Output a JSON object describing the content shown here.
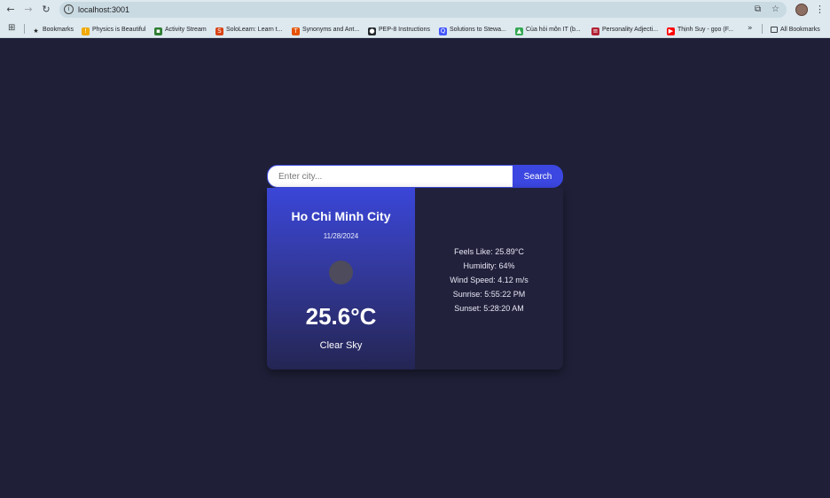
{
  "browser": {
    "url": "localhost:3001",
    "bookmarks": [
      {
        "label": "Bookmarks",
        "icon": "star-icon",
        "glyph": "★",
        "color": "#202124"
      },
      {
        "label": "Physics is Beautiful",
        "icon": "physics-favicon",
        "glyph": "!",
        "color": "#f2a900"
      },
      {
        "label": "Activity Stream",
        "icon": "activity-favicon",
        "glyph": "▪",
        "color": "#2e7d32"
      },
      {
        "label": "SoloLearn: Learn t...",
        "icon": "sololearn-favicon",
        "glyph": "S",
        "color": "#d84315"
      },
      {
        "label": "Synonyms and Ant...",
        "icon": "thesaurus-favicon",
        "glyph": "T",
        "color": "#e65100"
      },
      {
        "label": "PEP-8 Instructions",
        "icon": "github-favicon",
        "glyph": "●",
        "color": "#24292e"
      },
      {
        "label": "Solutions to Stewa...",
        "icon": "quizlet-favicon",
        "glyph": "Q",
        "color": "#4255ff"
      },
      {
        "label": "Của hỏi môn IT (b...",
        "icon": "drive-favicon",
        "glyph": "▲",
        "color": "#34a853"
      },
      {
        "label": "Personality Adjecti...",
        "icon": "flag-favicon",
        "glyph": "≡",
        "color": "#b22234"
      },
      {
        "label": "Thịnh Suy - gọo (F...",
        "icon": "youtube-favicon",
        "glyph": "▶",
        "color": "#ff0000"
      }
    ],
    "more_label": "»",
    "all_bookmarks_label": "All Bookmarks"
  },
  "search": {
    "placeholder": "Enter city...",
    "button_label": "Search"
  },
  "weather": {
    "city": "Ho Chi Minh City",
    "date": "11/28/2024",
    "temperature": "25.6°C",
    "condition": "Clear Sky",
    "icon": "weather-icon",
    "details": [
      "Feels Like: 25.89°C",
      "Humidity: 64%",
      "Wind Speed: 4.12 m/s",
      "Sunrise: 5:55:22 PM",
      "Sunset: 5:28:20 AM"
    ]
  },
  "colors": {
    "background": "#1f2038",
    "accent": "#3b47e0",
    "card": "#22213c"
  }
}
